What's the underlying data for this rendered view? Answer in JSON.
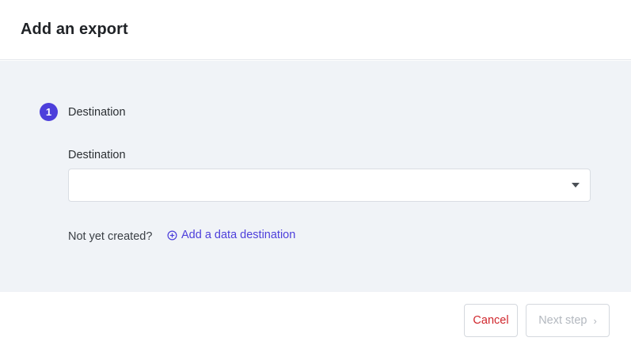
{
  "dialog": {
    "title": "Add an export"
  },
  "step": {
    "number": "1",
    "label": "Destination"
  },
  "destination_field": {
    "label": "Destination",
    "value": ""
  },
  "hint": {
    "text": "Not yet created?",
    "link_label": "Add a data destination"
  },
  "footer": {
    "cancel_label": "Cancel",
    "next_label": "Next step",
    "next_chevron": "›"
  },
  "colors": {
    "accent": "#4d3fdb",
    "danger": "#d0262c",
    "panel_bg": "#f0f3f7",
    "disabled_text": "#b3b8bf"
  },
  "icons": {
    "add_link_icon": "plus-circle-icon",
    "select_icon": "caret-down-icon",
    "next_icon": "chevron-right-icon"
  }
}
